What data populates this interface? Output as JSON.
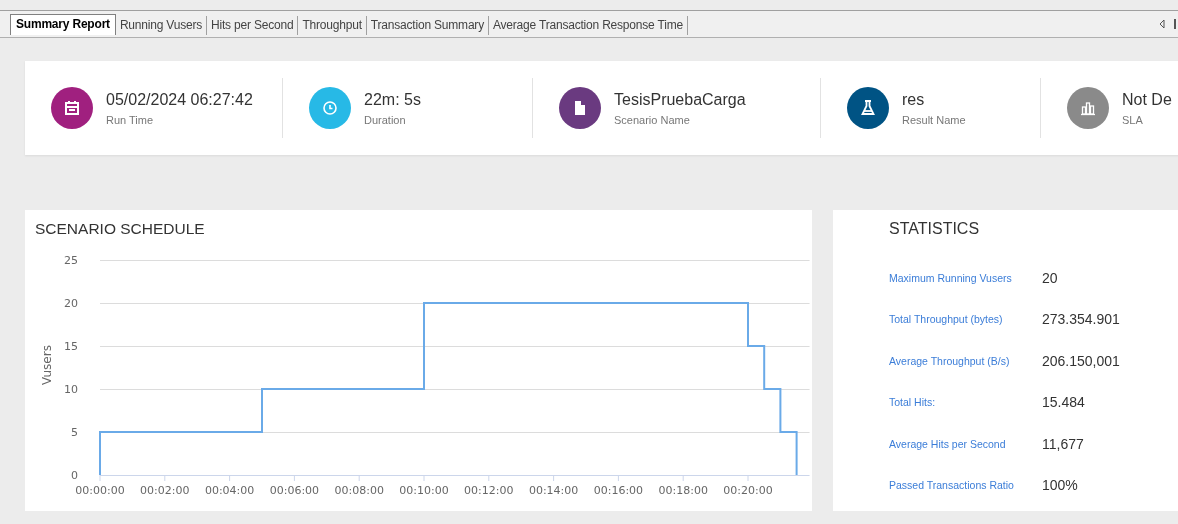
{
  "tabs": [
    {
      "label": "Summary Report",
      "selected": true
    },
    {
      "label": "Running Vusers",
      "selected": false
    },
    {
      "label": "Hits per Second",
      "selected": false
    },
    {
      "label": "Throughput",
      "selected": false
    },
    {
      "label": "Transaction Summary",
      "selected": false
    },
    {
      "label": "Average Transaction Response Time",
      "selected": false
    }
  ],
  "summary": [
    {
      "kind": "calendar",
      "color": "#a0207f",
      "value": "05/02/2024 06:27:42",
      "label": "Run Time"
    },
    {
      "kind": "clock",
      "color": "#27b9e6",
      "value": "22m: 5s",
      "label": "Duration"
    },
    {
      "kind": "document",
      "color": "#6a3a80",
      "value": "TesisPruebaCarga",
      "label": "Scenario Name"
    },
    {
      "kind": "flask",
      "color": "#005384",
      "value": "res",
      "label": "Result Name"
    },
    {
      "kind": "chart",
      "color": "#8a8a8a",
      "value": "Not De",
      "label": "SLA"
    }
  ],
  "schedule": {
    "title": "SCENARIO SCHEDULE",
    "chart_data": {
      "type": "line",
      "ylabel": "Vusers",
      "x": [
        0,
        0,
        5,
        5,
        10,
        10,
        20,
        20,
        20.5,
        20.5,
        21,
        21,
        21.5,
        21.5
      ],
      "grid": true,
      "series": [
        {
          "color": "#6aaae8",
          "values": [
            0,
            5,
            5,
            10,
            10,
            20,
            20,
            15,
            15,
            10,
            10,
            5,
            5,
            0
          ]
        }
      ],
      "xlim": [
        0,
        21.9
      ],
      "ylim": [
        0,
        25
      ],
      "xticks": [
        {
          "value": 0,
          "label": "00:00:00"
        },
        {
          "value": 2,
          "label": "00:02:00"
        },
        {
          "value": 4,
          "label": "00:04:00"
        },
        {
          "value": 6,
          "label": "00:06:00"
        },
        {
          "value": 8,
          "label": "00:08:00"
        },
        {
          "value": 10,
          "label": "00:10:00"
        },
        {
          "value": 12,
          "label": "00:12:00"
        },
        {
          "value": 14,
          "label": "00:14:00"
        },
        {
          "value": 16,
          "label": "00:16:00"
        },
        {
          "value": 18,
          "label": "00:18:00"
        },
        {
          "value": 20,
          "label": "00:20:00"
        }
      ],
      "yticks": [
        0,
        5,
        10,
        15,
        20,
        25
      ]
    }
  },
  "statistics": {
    "title": "STATISTICS",
    "rows": [
      {
        "label": "Maximum Running Vusers",
        "value": "20"
      },
      {
        "label": "Total Throughput (bytes)",
        "value": "273.354.901"
      },
      {
        "label": "Average Throughput (B/s)",
        "value": "206.150,001"
      },
      {
        "label": "Total Hits:",
        "value": "15.484"
      },
      {
        "label": "Average Hits per Second",
        "value": "11,677"
      },
      {
        "label": "Passed Transactions Ratio",
        "value": "100%"
      }
    ]
  }
}
